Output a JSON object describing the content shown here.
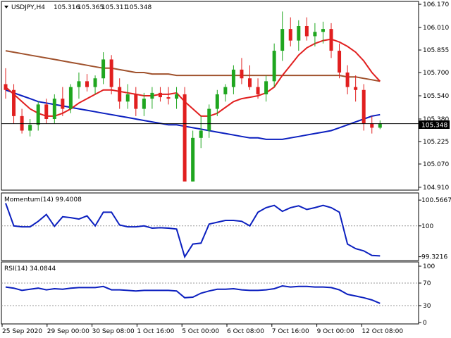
{
  "header": {
    "symbol_label": "USDJPY,H4",
    "open": "105.316",
    "high": "105.365",
    "low": "105.311",
    "close": "105.348"
  },
  "current_price_label": "105.348",
  "colors": {
    "bull": "#1fa61f",
    "bear": "#e11f1f",
    "ma_fast": "#e11f1f",
    "ma_mid": "#0b1fbf",
    "ma_slow": "#a0522d",
    "indicator": "#0b1fbf"
  },
  "chart_data": [
    {
      "type": "candlestick",
      "panel": "price",
      "y_ticks": [
        "106.170",
        "106.010",
        "105.855",
        "105.700",
        "105.540",
        "105.380",
        "105.225",
        "105.070",
        "104.910"
      ],
      "ylim": [
        104.9,
        106.18
      ],
      "candles": [
        [
          105.62,
          105.73,
          105.52,
          105.58
        ],
        [
          105.58,
          105.62,
          105.35,
          105.4
        ],
        [
          105.4,
          105.45,
          105.28,
          105.3
        ],
        [
          105.3,
          105.38,
          105.26,
          105.34
        ],
        [
          105.34,
          105.5,
          105.3,
          105.48
        ],
        [
          105.48,
          105.52,
          105.35,
          105.38
        ],
        [
          105.38,
          105.55,
          105.35,
          105.52
        ],
        [
          105.52,
          105.6,
          105.4,
          105.45
        ],
        [
          105.45,
          105.62,
          105.42,
          105.6
        ],
        [
          105.6,
          105.7,
          105.52,
          105.64
        ],
        [
          105.64,
          105.69,
          105.57,
          105.6
        ],
        [
          105.6,
          105.68,
          105.55,
          105.66
        ],
        [
          105.66,
          105.84,
          105.62,
          105.79
        ],
        [
          105.79,
          105.82,
          105.55,
          105.6
        ],
        [
          105.6,
          105.66,
          105.45,
          105.5
        ],
        [
          105.5,
          105.62,
          105.45,
          105.55
        ],
        [
          105.55,
          105.6,
          105.4,
          105.45
        ],
        [
          105.45,
          105.56,
          105.4,
          105.52
        ],
        [
          105.52,
          105.6,
          105.45,
          105.56
        ],
        [
          105.56,
          105.6,
          105.5,
          105.53
        ],
        [
          105.53,
          105.6,
          105.48,
          105.52
        ],
        [
          105.52,
          105.6,
          105.45,
          105.55
        ],
        [
          105.55,
          105.6,
          105.2,
          104.95
        ],
        [
          104.95,
          105.3,
          104.95,
          105.25
        ],
        [
          105.25,
          105.4,
          105.18,
          105.3
        ],
        [
          105.3,
          105.48,
          105.25,
          105.45
        ],
        [
          105.45,
          105.58,
          105.4,
          105.55
        ],
        [
          105.55,
          105.62,
          105.5,
          105.6
        ],
        [
          105.6,
          105.75,
          105.55,
          105.72
        ],
        [
          105.72,
          105.8,
          105.62,
          105.66
        ],
        [
          105.66,
          105.75,
          105.58,
          105.6
        ],
        [
          105.6,
          105.66,
          105.52,
          105.55
        ],
        [
          105.55,
          105.68,
          105.5,
          105.64
        ],
        [
          105.64,
          105.9,
          105.6,
          105.85
        ],
        [
          105.85,
          106.12,
          105.78,
          106.0
        ],
        [
          106.0,
          106.08,
          105.88,
          105.92
        ],
        [
          105.92,
          106.06,
          105.85,
          106.02
        ],
        [
          106.02,
          106.08,
          105.92,
          105.95
        ],
        [
          105.95,
          106.04,
          105.88,
          105.98
        ],
        [
          105.98,
          106.05,
          105.9,
          106.0
        ],
        [
          106.0,
          106.04,
          105.8,
          105.85
        ],
        [
          105.85,
          105.9,
          105.66,
          105.7
        ],
        [
          105.7,
          105.75,
          105.55,
          105.6
        ],
        [
          105.6,
          105.68,
          105.5,
          105.58
        ],
        [
          105.58,
          105.62,
          105.3,
          105.35
        ],
        [
          105.35,
          105.4,
          105.28,
          105.32
        ],
        [
          105.32,
          105.37,
          105.31,
          105.35
        ]
      ],
      "ma_fast": [
        105.6,
        105.55,
        105.5,
        105.45,
        105.42,
        105.4,
        105.4,
        105.42,
        105.45,
        105.49,
        105.52,
        105.55,
        105.58,
        105.58,
        105.57,
        105.56,
        105.55,
        105.54,
        105.54,
        105.55,
        105.55,
        105.56,
        105.5,
        105.45,
        105.4,
        105.4,
        105.42,
        105.46,
        105.5,
        105.52,
        105.53,
        105.54,
        105.56,
        105.6,
        105.68,
        105.75,
        105.82,
        105.87,
        105.9,
        105.92,
        105.93,
        105.91,
        105.88,
        105.84,
        105.78,
        105.7,
        105.64
      ],
      "ma_mid": [
        105.58,
        105.56,
        105.54,
        105.52,
        105.5,
        105.49,
        105.48,
        105.47,
        105.46,
        105.45,
        105.44,
        105.43,
        105.42,
        105.41,
        105.4,
        105.39,
        105.38,
        105.37,
        105.36,
        105.35,
        105.34,
        105.34,
        105.33,
        105.32,
        105.31,
        105.3,
        105.29,
        105.28,
        105.27,
        105.26,
        105.25,
        105.25,
        105.24,
        105.24,
        105.24,
        105.25,
        105.26,
        105.27,
        105.28,
        105.29,
        105.3,
        105.32,
        105.34,
        105.36,
        105.38,
        105.4,
        105.41
      ],
      "ma_slow": [
        105.85,
        105.84,
        105.83,
        105.82,
        105.81,
        105.8,
        105.79,
        105.78,
        105.77,
        105.76,
        105.75,
        105.74,
        105.73,
        105.73,
        105.72,
        105.71,
        105.7,
        105.7,
        105.69,
        105.69,
        105.69,
        105.68,
        105.68,
        105.68,
        105.68,
        105.68,
        105.68,
        105.68,
        105.68,
        105.68,
        105.68,
        105.68,
        105.68,
        105.68,
        105.68,
        105.68,
        105.68,
        105.68,
        105.68,
        105.68,
        105.68,
        105.68,
        105.67,
        105.67,
        105.66,
        105.65,
        105.64
      ],
      "last_close": 105.348
    },
    {
      "type": "line",
      "panel": "momentum",
      "title": "Momentum(14) 99.4008",
      "y_ticks": [
        "100.5667",
        "100",
        "99.3216"
      ],
      "level_line": 100,
      "ylim": [
        99.3,
        100.6
      ],
      "values": [
        100.5,
        100.0,
        99.98,
        99.98,
        100.1,
        100.25,
        99.99,
        100.2,
        100.18,
        100.15,
        100.22,
        100.0,
        100.3,
        100.3,
        100.02,
        99.98,
        99.98,
        100.0,
        99.95,
        99.96,
        99.95,
        99.93,
        99.32,
        99.6,
        99.62,
        100.04,
        100.08,
        100.12,
        100.12,
        100.1,
        100.0,
        100.3,
        100.4,
        100.45,
        100.32,
        100.4,
        100.44,
        100.36,
        100.4,
        100.45,
        100.4,
        100.3,
        99.6,
        99.5,
        99.45,
        99.35,
        99.34
      ]
    },
    {
      "type": "line",
      "panel": "rsi",
      "title": "RSI(14) 34.0844",
      "y_ticks": [
        "100",
        "70",
        "30",
        "0"
      ],
      "level_lines": [
        70,
        30
      ],
      "ylim": [
        0,
        100
      ],
      "values": [
        63,
        61,
        57,
        59,
        61,
        58,
        60,
        59,
        61,
        62,
        62,
        62,
        64,
        58,
        58,
        57,
        56,
        57,
        57,
        57,
        57,
        56,
        44,
        45,
        52,
        56,
        59,
        59,
        60,
        58,
        57,
        57,
        58,
        60,
        65,
        63,
        64,
        64,
        63,
        63,
        62,
        58,
        50,
        47,
        44,
        40,
        34
      ]
    }
  ],
  "x_axis_labels": [
    "25 Sep 2020",
    "29 Sep 00:00",
    "30 Sep 08:00",
    "1 Oct 16:00",
    "5 Oct 00:00",
    "6 Oct 08:00",
    "7 Oct 16:00",
    "9 Oct 00:00",
    "12 Oct 08:00"
  ]
}
